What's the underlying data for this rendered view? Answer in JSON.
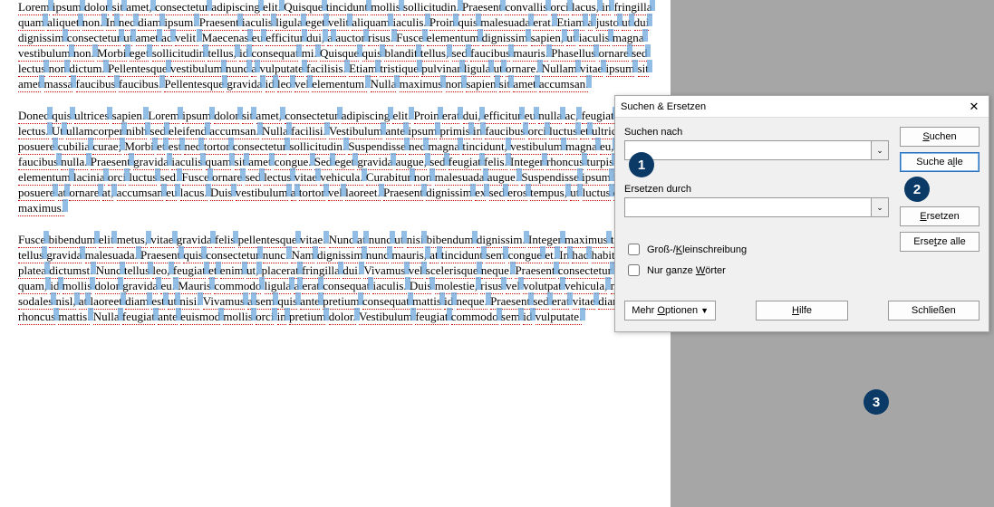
{
  "document": {
    "paragraphs": [
      "Lorem ipsum dolor sit amet, consectetur adipiscing elit. Quisque tincidunt mollis sollicitudin. Praesent convallis orci lacus, in fringilla quam aliquet non. In nec diam ipsum. Praesent iaculis ligula eget velit aliquam iaculis. Proin quis malesuada erat. Etiam a justo ut dui dignissim consectetur ut amet ac velit. Maecenas eu efficitur dui, a auctor risus. Fusce elementum dignissim sapien, ut iaculis magna vestibulum non. Morbi eget sollicitudin tellus, id consequat mi. Quisque quis blandit tellus, sed faucibus mauris. Phasellus ornare sed lectus non dictum. Pellentesque vestibulum nunc a vulputate facilisis. Etiam tristique pulvinar ligula ut ornare. Nullam vitae ipsum sit amet massa faucibus faucibus. Pellentesque gravida id leo vel elementum. Nulla maximus non sapien sit amet accumsan.",
      "Donec quis ultrices sapien. Lorem ipsum dolor sit amet, consectetur adipiscing elit. Proin erat dui, efficitur eu nulla ac, feugiat viverra lectus. Ut ullamcorper nibh sed eleifend accumsan. Nulla facilisi. Vestibulum ante ipsum primis in faucibus orci luctus et ultrices posuere cubilia curae; Morbi et est nec tortor consectetur sollicitudin. Suspendisse nec magna tincidunt, vestibulum magna eu, faucibus nulla. Praesent gravida iaculis quam sit amet congue. Sed eget gravida augue, sed feugiat felis. Integer rhoncus turpis justo, elementum lacinia orci luctus sed. Fusce ornare sed lectus vitae vehicula. Curabitur non malesuada augue. Suspendisse ipsum magna, posuere at ornare at, accumsan eu lacus. Duis vestibulum a tortor vel laoreet. Praesent dignissim ex sed eros tempus, ut luctus est maximus.",
      "Fusce bibendum elit metus, vitae gravida felis pellentesque vitae. Nunc at nunc ut nisi bibendum dignissim. Integer maximus tellus et tellus gravida malesuada. Praesent quis consectetur nunc. Nam dignissim nunc mauris, at tincidunt sem congue et. In hac habitasse platea dictumst. Nunc tellus leo, feugiat et enim ut, placerat fringilla dui. Vivamus vel scelerisque neque. Praesent consectetur erat quam, id mollis dolor gravida eu. Mauris commodo ligula a erat consequat iaculis. Duis molestie, risus vel volutpat vehicula, nisi nisi sodales nisl, at laoreet diam est ut nisi. Vivamus a sem quis ante pretium consequat mattis id neque. Praesent sed erat vitae diam rhoncus mattis. Nulla feugiat ante euismod mollis orci in pretium dolor. Vestibulum feugiat commodo sem id vulputate."
    ]
  },
  "dialog": {
    "title": "Suchen & Ersetzen",
    "search_label": "Suchen nach",
    "search_value": "",
    "replace_label": "Ersetzen durch",
    "replace_value": "",
    "case_label": "Groß-/Kleinschreibung",
    "whole_label": "Nur ganze Wörter",
    "btn_search": "Suchen",
    "btn_search_all": "Suche alle",
    "btn_replace": "Ersetzen",
    "btn_replace_all": "Ersetze alle",
    "btn_more": "Mehr Optionen",
    "btn_help": "Hilfe",
    "btn_close": "Schließen"
  },
  "steps": {
    "s1": "1",
    "s2": "2",
    "s3": "3"
  }
}
